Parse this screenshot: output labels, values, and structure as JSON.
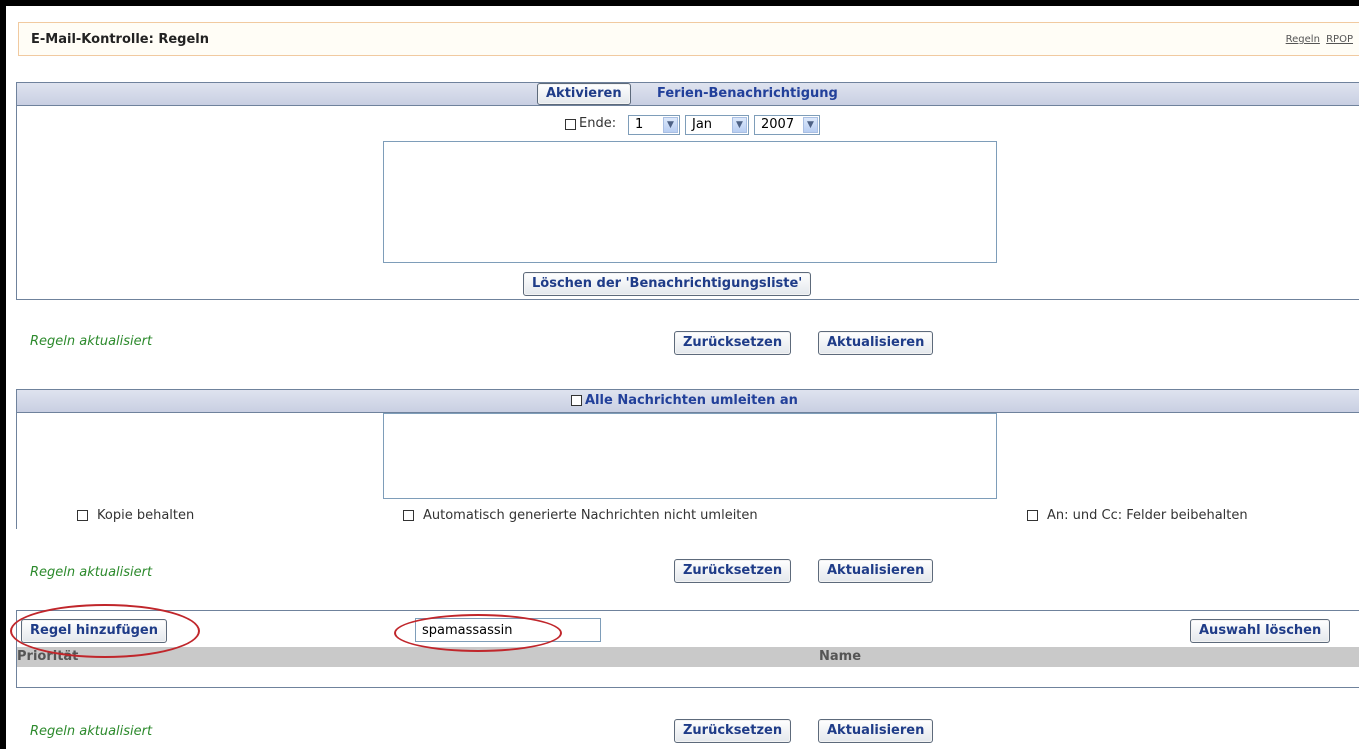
{
  "header": {
    "title": "E-Mail-Kontrolle: Regeln",
    "links": [
      "Regeln",
      "RPOP"
    ]
  },
  "vacation": {
    "activate_button": "Aktivieren",
    "title": "Ferien-Benachrichtigung",
    "end_label": "Ende:",
    "day": "1",
    "month": "Jan",
    "year": "2007",
    "clear_list_button": "Löschen der 'Benachrichtigungsliste'"
  },
  "forms": {
    "status": "Regeln aktualisiert",
    "reset_button": "Zurücksetzen",
    "update_button": "Aktualisieren"
  },
  "forward": {
    "title": "Alle Nachrichten umleiten an",
    "keep_copy": "Kopie behalten",
    "no_auto": "Automatisch generierte Nachrichten nicht umleiten",
    "keep_headers": "An: und Cc: Felder beibehalten"
  },
  "rules": {
    "add_button": "Regel hinzufügen",
    "rule_name_value": "spamassassin",
    "clear_selection_button": "Auswahl löschen",
    "columns": [
      "Priorität",
      "Name"
    ]
  },
  "colors": {
    "accent": "#22409a",
    "status": "#2c8a2c",
    "highlight": "#c0262b"
  }
}
